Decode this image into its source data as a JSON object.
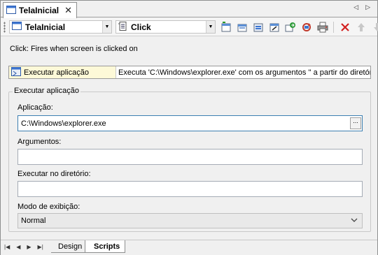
{
  "window": {
    "tab_title": "TelaInicial"
  },
  "toolbar": {
    "object_combo": "TelaInicial",
    "event_combo": "Click"
  },
  "event_description": "Click: Fires when screen is clicked on",
  "action": {
    "name": "Executar aplicação",
    "description": "Executa 'C:\\Windows\\explorer.exe' com os argumentos '' a partir do diretório ''"
  },
  "group": {
    "title": "Executar aplicação",
    "application_label": "Aplicação:",
    "application_value": "C:\\Windows\\explorer.exe",
    "browse_label": "...",
    "arguments_label": "Argumentos:",
    "arguments_value": "",
    "workdir_label": "Executar no diretório:",
    "workdir_value": "",
    "mode_label": "Modo de exibição:",
    "mode_value": "Normal"
  },
  "bottom_tabs": {
    "design": "Design",
    "scripts": "Scripts"
  },
  "colors": {
    "action_highlight": "#fdf9d8",
    "delete_icon": "#d22020",
    "focus_border": "#3c7fb1"
  }
}
